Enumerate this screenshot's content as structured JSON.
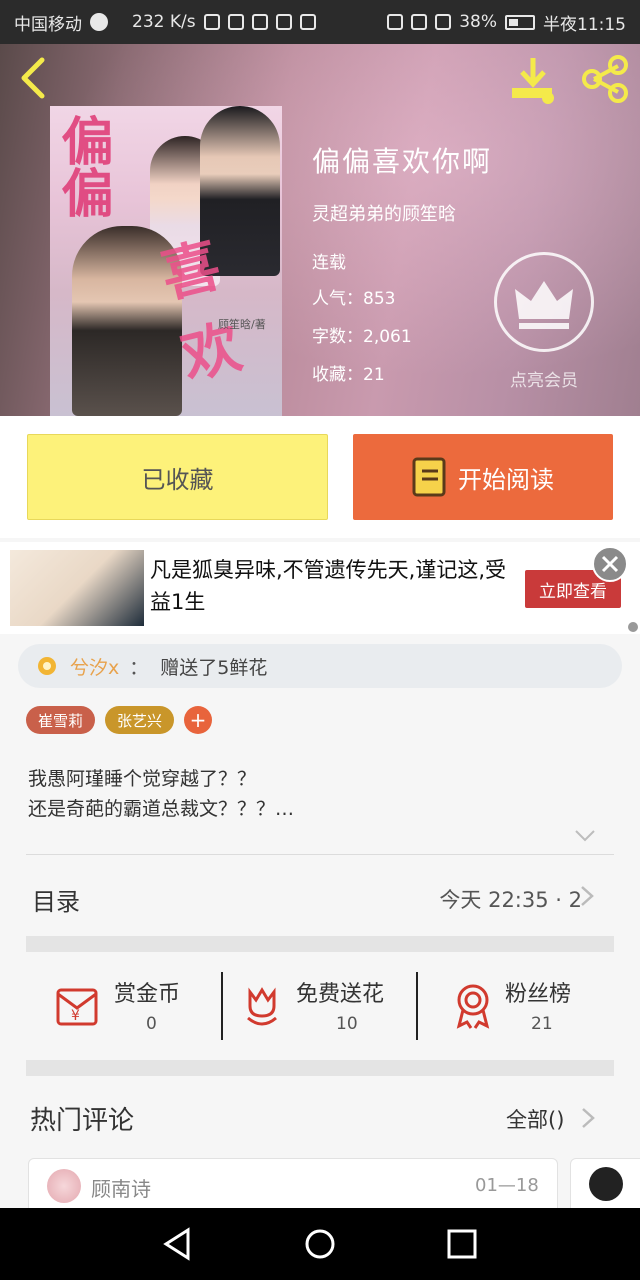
{
  "status_bar": {
    "carrier": "中国移动",
    "speed": "232 K/s",
    "battery": "38%",
    "time": "半夜11:15"
  },
  "book": {
    "title": "偏偏喜欢你啊",
    "author": "灵超弟弟的顾笙晗",
    "status": "连载",
    "popularity": "人气：853",
    "word_count": "字数：2,061",
    "favorites": "收藏：21",
    "vip_label": "点亮会员",
    "cover_text": "偏偏",
    "cover_text2": "喜欢",
    "cover_credit": "顾笙晗/著"
  },
  "actions": {
    "favorited_label": "已收藏",
    "read_label": "开始阅读"
  },
  "ad": {
    "text": "凡是狐臭异味,不管遗传先天,谨记这,受益1生",
    "cta": "立即查看"
  },
  "gift_notice": {
    "user": "兮汐x",
    "separator": "：",
    "message": "赠送了5鲜花"
  },
  "tags": [
    {
      "label": "崔雪莉",
      "color": "#c9604a"
    },
    {
      "label": "张艺兴",
      "color": "#c9962a"
    }
  ],
  "tag_add": "+",
  "description": {
    "line1": "我愚阿瑾睡个觉穿越了？？",
    "line2": "还是奇葩的霸道总裁文？？？…"
  },
  "toc": {
    "label": "目录",
    "info": "今天 22:35 · 2"
  },
  "stats": [
    {
      "label": "赏金币",
      "value": "0",
      "icon": "red-envelope-icon"
    },
    {
      "label": "免费送花",
      "value": "10",
      "icon": "flower-icon"
    },
    {
      "label": "粉丝榜",
      "value": "21",
      "icon": "badge-icon"
    }
  ],
  "comments": {
    "title": "热门评论",
    "all_label": "全部()",
    "first": {
      "name": "顾南诗",
      "date": "01—18"
    }
  },
  "colors": {
    "accent_orange": "#ec6a3d",
    "fav_yellow": "#fdf27a",
    "icon_red": "#d13a2e"
  }
}
